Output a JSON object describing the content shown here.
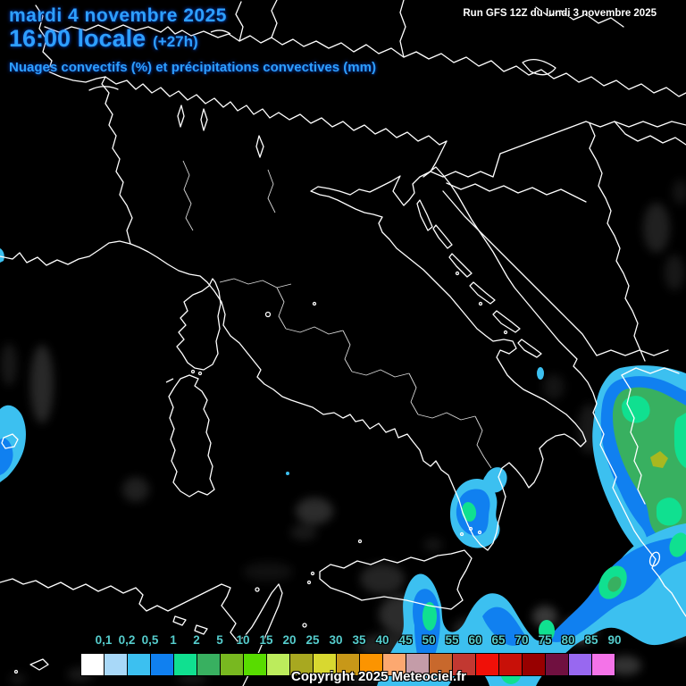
{
  "header": {
    "date": "mardi 4 novembre 2025",
    "time": "16:00 locale",
    "offset": "(+27h)",
    "subtitle": "Nuages convectifs (%) et précipitations convectives (mm)",
    "run": "Run GFS 12Z du lundi 3 novembre 2025",
    "accent_color": "#2E9FFF"
  },
  "legend": {
    "labels": [
      "0,1",
      "0,2",
      "0,5",
      "1",
      "2",
      "5",
      "10",
      "15",
      "20",
      "25",
      "30",
      "35",
      "40",
      "45",
      "50",
      "55",
      "60",
      "65",
      "70",
      "75",
      "80",
      "85",
      "90"
    ],
    "colors": [
      "#FFFFFF",
      "#A8D8F8",
      "#3CC0F0",
      "#1080F0",
      "#10E090",
      "#38B060",
      "#78B820",
      "#58DC00",
      "#BCEC5C",
      "#A8A820",
      "#D8D830",
      "#C89818",
      "#FC9400",
      "#FCA870",
      "#C49CA8",
      "#C8682C",
      "#C23831",
      "#F01008",
      "#C81008",
      "#980000",
      "#701040",
      "#9868F0",
      "#F473E8"
    ],
    "label_color": "#55CCCC"
  },
  "map": {
    "palette": {
      "coast": "#FFFFFF",
      "cloud": "#C8C8C8",
      "p01": "#A8D8F8",
      "p02": "#3CC0F0",
      "p05": "#1080F0",
      "p1": "#10E090",
      "p2": "#38B060",
      "p5": "#A8B820"
    }
  },
  "footer": {
    "copyright": "Copyright 2025 Meteociel.fr"
  }
}
